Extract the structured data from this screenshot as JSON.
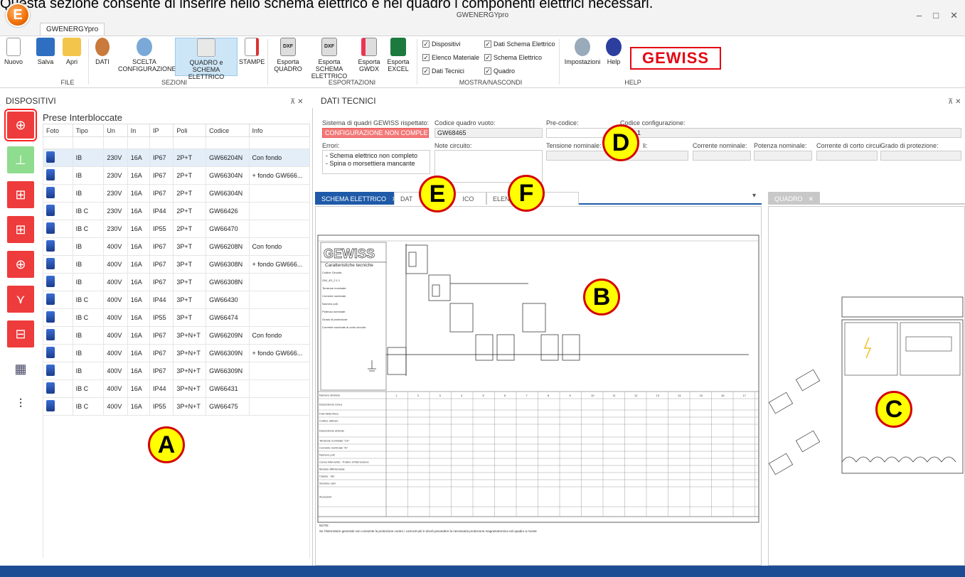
{
  "caption": "Questa sezione consente di inserire nello schema elettrico e nel quadro i componenti elettrici necessari.",
  "window": {
    "title": "GWENERGYpro",
    "minimize": "–",
    "maximize": "□",
    "close": "✕"
  },
  "app_logo_letter": "E",
  "ribbon": {
    "tab": "GWENERGYpro",
    "buttons": {
      "nuovo": "Nuovo",
      "salva": "Salva",
      "apri": "Apri",
      "dati": "DATI",
      "scelta": "SCELTA CONFIGURAZIONE",
      "quadro": "QUADRO e SCHEMA ELETTRICO",
      "stampe": "STAMPE",
      "esp_quadro": "Esporta QUADRO",
      "esp_schema": "Esporta SCHEMA ELETTRICO",
      "esp_gwdx": "Esporta GWDX",
      "esp_excel": "Esporta EXCEL",
      "impostazioni": "Impostazioni",
      "help": "Help"
    },
    "checkboxes": {
      "dispositivi": "Dispositivi",
      "elenco": "Elenco Materiale",
      "dati_tecnici": "Dati Tecnici",
      "dati_schema": "Dati Schema Elettrico",
      "schema": "Schema Elettrico",
      "quadro": "Quadro"
    },
    "groups": {
      "file": "FILE",
      "sezioni": "SEZIONI",
      "esportazioni": "ESPORTAZIONI",
      "mostra": "MOSTRA/NASCONDI",
      "help": "HELP"
    },
    "dxf": "DXF",
    "brand": "GEWISS"
  },
  "left_panel": {
    "title": "DISPOSITIVI",
    "pin": "⊼ ✕",
    "subtitle": "Prese Interbloccate",
    "headers": [
      "Foto",
      "Tipo",
      "Un",
      "In",
      "IP",
      "Poli",
      "Codice",
      "Info"
    ],
    "rows": [
      [
        "IB",
        "230V",
        "16A",
        "IP67",
        "2P+T",
        "GW66204N",
        "Con fondo"
      ],
      [
        "IB",
        "230V",
        "16A",
        "IP67",
        "2P+T",
        "GW66304N",
        "+ fondo GW666..."
      ],
      [
        "IB",
        "230V",
        "16A",
        "IP67",
        "2P+T",
        "GW66304N",
        ""
      ],
      [
        "IB C",
        "230V",
        "16A",
        "IP44",
        "2P+T",
        "GW66426",
        ""
      ],
      [
        "IB C",
        "230V",
        "16A",
        "IP55",
        "2P+T",
        "GW66470",
        ""
      ],
      [
        "IB",
        "400V",
        "16A",
        "IP67",
        "3P+T",
        "GW66208N",
        "Con fondo"
      ],
      [
        "IB",
        "400V",
        "16A",
        "IP67",
        "3P+T",
        "GW66308N",
        "+ fondo GW666..."
      ],
      [
        "IB",
        "400V",
        "16A",
        "IP67",
        "3P+T",
        "GW66308N",
        ""
      ],
      [
        "IB C",
        "400V",
        "16A",
        "IP44",
        "3P+T",
        "GW66430",
        ""
      ],
      [
        "IB C",
        "400V",
        "16A",
        "IP55",
        "3P+T",
        "GW66474",
        ""
      ],
      [
        "IB",
        "400V",
        "16A",
        "IP67",
        "3P+N+T",
        "GW66209N",
        "Con fondo"
      ],
      [
        "IB",
        "400V",
        "16A",
        "IP67",
        "3P+N+T",
        "GW66309N",
        "+ fondo GW666..."
      ],
      [
        "IB",
        "400V",
        "16A",
        "IP67",
        "3P+N+T",
        "GW66309N",
        ""
      ],
      [
        "IB C",
        "400V",
        "16A",
        "IP44",
        "3P+N+T",
        "GW66431",
        ""
      ],
      [
        "IB C",
        "400V",
        "16A",
        "IP55",
        "3P+N+T",
        "GW66475",
        ""
      ]
    ]
  },
  "tech": {
    "title": "DATI TECNICI",
    "pin": "⊼ ✕",
    "sistema_label": "Sistema di quadri GEWISS rispettato:",
    "sistema_value": "CONFIGURAZIONE NON COMPLETA",
    "codice_vuoto_label": "Codice quadro vuoto:",
    "codice_vuoto_value": "GW68465",
    "precodice_label": "Pre-codice:",
    "precodice_value": "",
    "codice_conf_label": "Codice configurazione:",
    "codice_conf_value": "_2.1.1",
    "errori_label": "Errori:",
    "errori_lines": [
      "- Schema elettrico non completo",
      "- Spina o morsettiera mancante"
    ],
    "note_label": "Note circuito:",
    "tensione_label": "Tensione nominale:",
    "poli_label": "li:",
    "corrente_label": "Corrente nominale:",
    "potenza_label": "Potenza nominale:",
    "corto_label": "Corrente di corto circui",
    "grado_label": "Grado di protezione:"
  },
  "tabs": {
    "schema": "SCHEMA ELETTRICO",
    "dat": "DAT",
    "ico": "ICO",
    "elen": "ELEN",
    "close": "✕",
    "dropdown": "▾",
    "quadro": "QUADRO"
  },
  "sheet": {
    "brand": "GEWISS",
    "caratteristiche": "Caratteristiche tecniche",
    "fields": [
      "Codice Circuito:",
      "GW_4S_2.1.1",
      "Tensione nominale:",
      "Corrente nominale:",
      "Numero poli:",
      "Potenza nominale:",
      "Grado di protezione:",
      "Corrente nominale di corto circuito:"
    ],
    "table_rows": [
      "Numero simbolo",
      "Descrizione Linea",
      "Fasi della linea",
      "Codice articolo",
      "Descrizione articolo",
      "Tensione nominale \"Un\"",
      "Corrente nominale \"In\"",
      "Numero poli",
      "Curva intervento - Potere d'interruzione",
      "Modulo differenziale",
      "Classe - Idn",
      "Sezione cavi",
      "Accessori"
    ],
    "note": "NOTE:",
    "note_text": "Se l'interruttore generale non consente la protezione contro i cortocircuiti è dovrà prevedere la necessaria protezione magnetotermica nel quadro a monte"
  },
  "callouts": {
    "a": "A",
    "b": "B",
    "c": "C",
    "d": "D",
    "e": "E",
    "f": "F"
  },
  "colors": {
    "accent": "#1e5aa8",
    "error": "#f27979",
    "tool_red": "#ee3b3b",
    "tool_green": "#8edc8e",
    "callout_fill": "#ffff00",
    "callout_border": "#d40000"
  }
}
